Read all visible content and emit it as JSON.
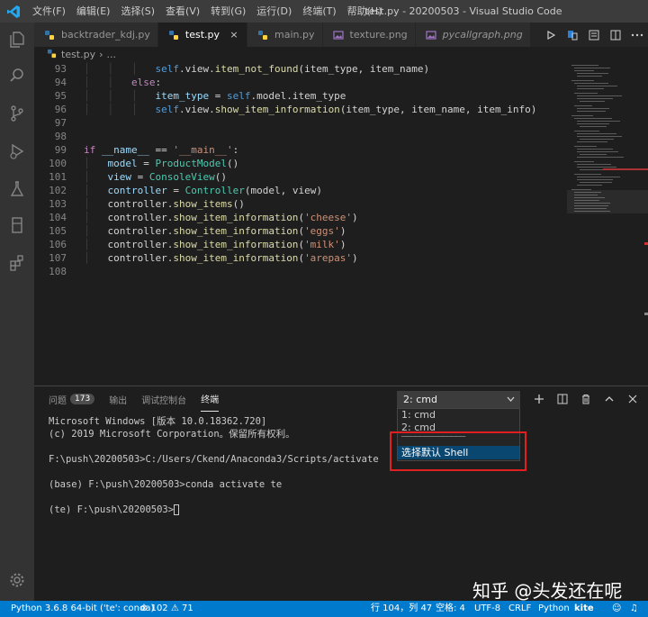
{
  "titlebar": {
    "menus": [
      "文件(F)",
      "编辑(E)",
      "选择(S)",
      "查看(V)",
      "转到(G)",
      "运行(D)",
      "终端(T)",
      "帮助(H)"
    ],
    "window_title": "test.py - 20200503 - Visual Studio Code"
  },
  "tabs": [
    {
      "label": "backtrader_kdj.py",
      "icon": "python-file-icon"
    },
    {
      "label": "test.py",
      "icon": "python-file-icon",
      "active": true,
      "close": "×"
    },
    {
      "label": "main.py",
      "icon": "python-file-icon"
    },
    {
      "label": "texture.png",
      "icon": "image-file-icon"
    },
    {
      "label": "pycallgraph.png",
      "icon": "image-file-icon"
    }
  ],
  "breadcrumb": {
    "file": "test.py",
    "sep": "›",
    "more": "..."
  },
  "editor": {
    "lines": [
      {
        "n": "93",
        "tokens": [
          [
            "g",
            "│   │   │   "
          ],
          [
            "slf",
            "self"
          ],
          [
            "",
            ".view."
          ],
          [
            "fn",
            "item_not_found"
          ],
          [
            "",
            "(item_type, item_name)"
          ]
        ]
      },
      {
        "n": "94",
        "tokens": [
          [
            "g",
            "│   │   "
          ],
          [
            "kw",
            "else"
          ],
          [
            "",
            ":"
          ]
        ]
      },
      {
        "n": "95",
        "tokens": [
          [
            "g",
            "│   │   │   "
          ],
          [
            "var",
            "item_type"
          ],
          [
            "",
            " = "
          ],
          [
            "slf",
            "self"
          ],
          [
            "",
            ".model.item_type"
          ]
        ]
      },
      {
        "n": "96",
        "tokens": [
          [
            "g",
            "│   │   │   "
          ],
          [
            "slf",
            "self"
          ],
          [
            "",
            ".view."
          ],
          [
            "fn",
            "show_item_information"
          ],
          [
            "",
            "(item_type, item_name, item_info)"
          ]
        ]
      },
      {
        "n": "97",
        "tokens": []
      },
      {
        "n": "98",
        "tokens": []
      },
      {
        "n": "99",
        "tokens": [
          [
            "kw",
            "if"
          ],
          [
            "",
            " "
          ],
          [
            "var",
            "__name__"
          ],
          [
            "",
            " == "
          ],
          [
            "str",
            "'__main__'"
          ],
          [
            "",
            ":"
          ]
        ]
      },
      {
        "n": "100",
        "tokens": [
          [
            "g",
            "│   "
          ],
          [
            "var",
            "model"
          ],
          [
            "",
            " = "
          ],
          [
            "cls",
            "ProductModel"
          ],
          [
            "",
            "()"
          ]
        ]
      },
      {
        "n": "101",
        "tokens": [
          [
            "g",
            "│   "
          ],
          [
            "var",
            "view"
          ],
          [
            "",
            " = "
          ],
          [
            "cls",
            "ConsoleView"
          ],
          [
            "",
            "()"
          ]
        ]
      },
      {
        "n": "102",
        "tokens": [
          [
            "g",
            "│   "
          ],
          [
            "var",
            "controller"
          ],
          [
            "",
            " = "
          ],
          [
            "cls",
            "Controller"
          ],
          [
            "",
            "(model, view)"
          ]
        ]
      },
      {
        "n": "103",
        "tokens": [
          [
            "g",
            "│   "
          ],
          [
            "",
            "controller."
          ],
          [
            "fn",
            "show_items"
          ],
          [
            "",
            "()"
          ]
        ]
      },
      {
        "n": "104",
        "tokens": [
          [
            "g",
            "│   "
          ],
          [
            "",
            "controller."
          ],
          [
            "fn",
            "show_item_information"
          ],
          [
            "",
            "("
          ],
          [
            "str",
            "'cheese'"
          ],
          [
            "",
            ")"
          ]
        ]
      },
      {
        "n": "105",
        "tokens": [
          [
            "g",
            "│   "
          ],
          [
            "",
            "controller."
          ],
          [
            "fn",
            "show_item_information"
          ],
          [
            "",
            "("
          ],
          [
            "str",
            "'eggs'"
          ],
          [
            "",
            ")"
          ]
        ]
      },
      {
        "n": "106",
        "tokens": [
          [
            "g",
            "│   "
          ],
          [
            "",
            "controller."
          ],
          [
            "fn",
            "show_item_information"
          ],
          [
            "",
            "("
          ],
          [
            "str",
            "'milk'"
          ],
          [
            "",
            ")"
          ]
        ]
      },
      {
        "n": "107",
        "tokens": [
          [
            "g",
            "│   "
          ],
          [
            "",
            "controller."
          ],
          [
            "fn",
            "show_item_information"
          ],
          [
            "",
            "("
          ],
          [
            "str",
            "'arepas'"
          ],
          [
            "",
            ")"
          ]
        ]
      },
      {
        "n": "108",
        "tokens": []
      }
    ]
  },
  "panel": {
    "tabs": [
      "问题",
      "输出",
      "调试控制台",
      "终端"
    ],
    "problems_badge": "173",
    "active_tab": "终端",
    "shell_select": "2: cmd",
    "dropdown": {
      "options": [
        "1: cmd",
        "2: cmd"
      ],
      "divider": "──────────────",
      "default_shell": "选择默认 Shell"
    },
    "terminal_lines": [
      "Microsoft Windows [版本 10.0.18362.720]",
      "(c) 2019 Microsoft Corporation。保留所有权利。",
      "",
      "F:\\push\\20200503>C:/Users/Ckend/Anaconda3/Scripts/activate",
      "",
      "(base) F:\\push\\20200503>conda activate te",
      "",
      "(te) F:\\push\\20200503>"
    ]
  },
  "watermark": "知乎 @头发还在呢",
  "statusbar": {
    "interpreter": "Python 3.6.8 64-bit ('te': conda)",
    "errors": "102",
    "warnings": "71",
    "position": "行 104，列 47",
    "spaces": "空格: 4",
    "encoding": "UTF-8",
    "eol": "CRLF",
    "language": "Python",
    "kite": "kite"
  },
  "colors": {
    "accent": "#007acc",
    "highlight_box": "#e02020"
  }
}
